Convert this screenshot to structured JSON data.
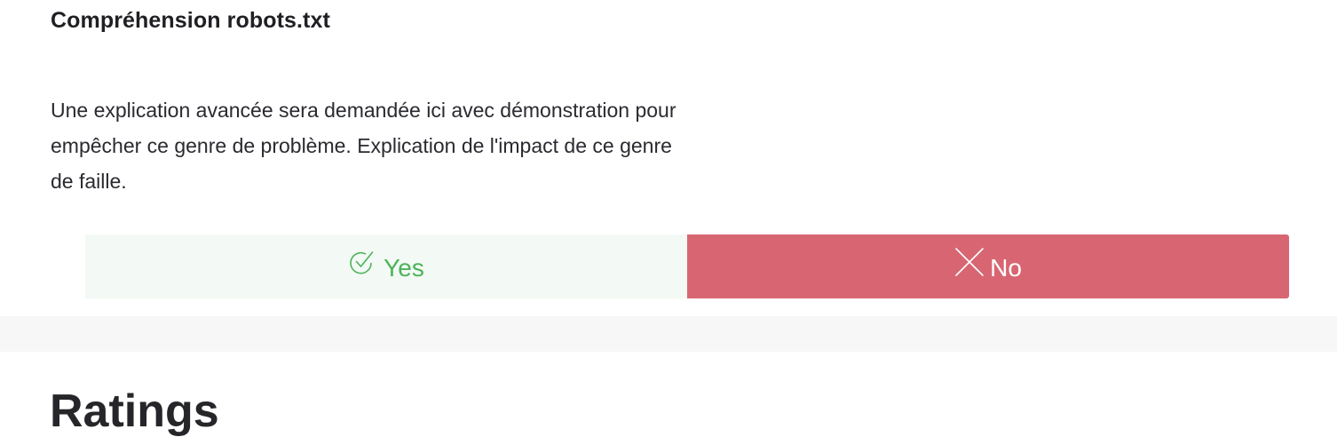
{
  "question": {
    "title": "Compréhension robots.txt",
    "description": "Une explication avancée sera demandée ici avec démonstration pour empêcher ce genre de problème. Explication de l'impact de ce genre de faille."
  },
  "answers": {
    "yes": {
      "label": "Yes",
      "icon": "check-circle-icon",
      "color": "#4cb35b",
      "background": "#f3f9f4"
    },
    "no": {
      "label": "No",
      "icon": "close-icon",
      "color": "#ffffff",
      "background": "#d86672"
    }
  },
  "ratings": {
    "title": "Ratings"
  }
}
